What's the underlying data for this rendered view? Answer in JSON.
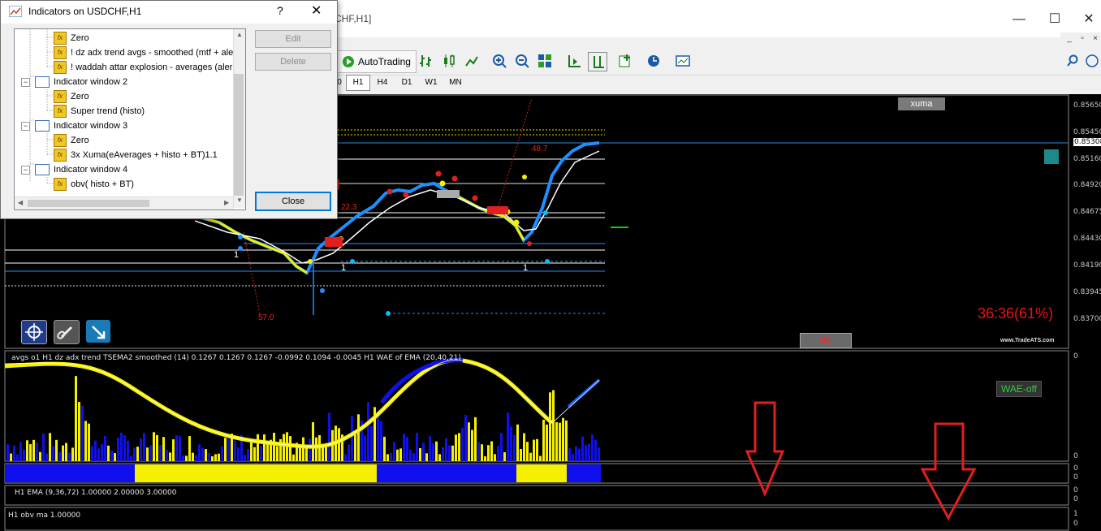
{
  "window": {
    "title": "Indicators on USDCHF,H1",
    "background_title": "CHF,H1]",
    "controls": {
      "minimize": "—",
      "maximize": "☐",
      "close": "✕",
      "help": "?"
    }
  },
  "dialog": {
    "tree": [
      {
        "type": "indicator",
        "label": "Zero",
        "level": 2
      },
      {
        "type": "indicator",
        "label": "! dz adx trend avgs - smoothed (mtf + ale",
        "level": 2
      },
      {
        "type": "indicator",
        "label": "! waddah attar explosion - averages (aler",
        "level": 2
      },
      {
        "type": "window",
        "label": "Indicator window 2",
        "level": 1
      },
      {
        "type": "indicator",
        "label": "Zero",
        "level": 2
      },
      {
        "type": "indicator",
        "label": "Super trend (histo)",
        "level": 2
      },
      {
        "type": "window",
        "label": "Indicator window 3",
        "level": 1
      },
      {
        "type": "indicator",
        "label": "Zero",
        "level": 2
      },
      {
        "type": "indicator",
        "label": "3x Xuma(eAverages + histo + BT)1.1",
        "level": 2
      },
      {
        "type": "window",
        "label": "Indicator window 4",
        "level": 1
      },
      {
        "type": "indicator",
        "label": "obv( histo + BT)",
        "level": 2
      }
    ],
    "buttons": {
      "edit": "Edit",
      "delete": "Delete",
      "close": "Close"
    }
  },
  "toolbar": {
    "autotrading": "AutoTrading",
    "timeframes": [
      "0",
      "H1",
      "H4",
      "D1",
      "W1",
      "MN"
    ],
    "active_timeframe": "H1"
  },
  "chart": {
    "price_axis": [
      "0.85650",
      "0.85450",
      "0.85308",
      "0.85160",
      "0.84920",
      "0.84675",
      "0.84430",
      "0.84190",
      "0.83945",
      "0.83700"
    ],
    "current_price": "0.85308",
    "annotations": {
      "a1": "48.7",
      "a2": "22.3",
      "a3": "57.0",
      "n1": "1",
      "n2": "1",
      "n3": "1"
    },
    "xuma_button": "xuma",
    "obv_button": "obv",
    "wae_button": "WAE-off",
    "percent_label": "36:36(61%)",
    "brand": "www.TradeATS.com"
  },
  "panes": {
    "p1_label": "avgs o1 H1 dz adx trend TSEMA2 smoothed (14) 0.1267 0.1267 0.1267 -0.0992 0.1094 -0.0045  H1 WAE of EMA (20,40,21)",
    "p1_ticks": [
      "0",
      "0"
    ],
    "p2_ticks": [
      "0",
      "0"
    ],
    "p3_label": "H1 EMA (9,36,72) 1.00000 2.00000 3.00000",
    "p3_ticks": [
      "0",
      "0"
    ],
    "p4_label": "H1 obv ma 1.00000",
    "p4_ticks": [
      "1",
      "0"
    ]
  },
  "colors": {
    "up": "#1e8fff",
    "down": "#ffff00",
    "blue_hist": "#1010ee",
    "yellow_hist": "#f5f000",
    "arrow_red": "#e02020"
  }
}
